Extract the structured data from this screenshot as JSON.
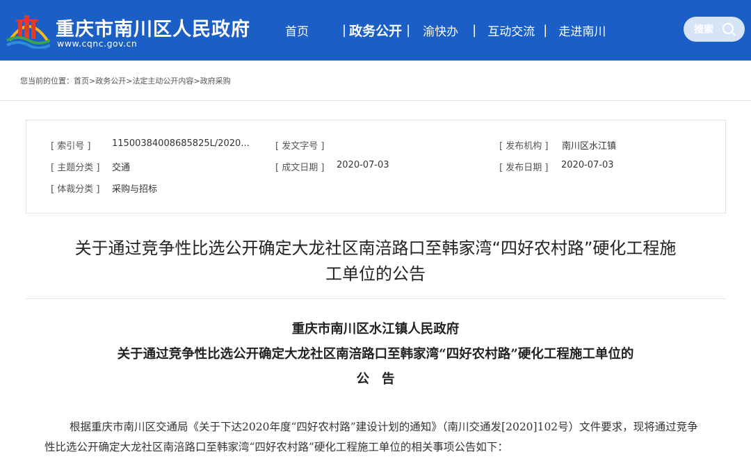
{
  "header": {
    "site_name": "重庆市南川区人民政府",
    "site_url": "www.cqnc.gov.cn",
    "nav": [
      {
        "label": "首页",
        "active": false
      },
      {
        "label": "政务公开",
        "active": true
      },
      {
        "label": "渝快办",
        "active": false
      },
      {
        "label": "互动交流",
        "active": false
      },
      {
        "label": "走进南川",
        "active": false
      }
    ],
    "nav_separator": "|",
    "search_label": "搜索",
    "colors": {
      "bar": "#1a5ec6",
      "search_bg": "#d7e4f5",
      "logo_red": "#e23b2a",
      "logo_yellow": "#f6b81a",
      "logo_green": "#3aa54a"
    }
  },
  "breadcrumb": {
    "prefix": "您当前的位置：",
    "items": [
      "首页",
      "政务公开",
      "法定主动公开内容",
      "政府采购"
    ],
    "separator": ">"
  },
  "meta": {
    "index_no_label": "[ 索引号 ]",
    "index_no_value": "11500384008685825L/2020...",
    "doc_no_label": "[ 发文字号 ]",
    "doc_no_value": "",
    "publisher_label": "[ 发布机构 ]",
    "publisher_value": "南川区水江镇",
    "topic_label": "[ 主题分类 ]",
    "topic_value": "交通",
    "written_date_label": "[ 成文日期 ]",
    "written_date_value": "2020-07-03",
    "publish_date_label": "[ 发布日期 ]",
    "publish_date_value": "2020-07-03",
    "genre_label": "[ 体裁分类 ]",
    "genre_value": "采购与招标"
  },
  "article": {
    "title_line1": "关于通过竞争性比选公开确定大龙社区南涪路口至韩家湾“四好农村路”硬化工程施",
    "title_line2": "工单位的公告",
    "issuer": "重庆市南川区水江镇人民政府",
    "subject": "关于通过竞争性比选公开确定大龙社区南涪路口至韩家湾“四好农村路”硬化工程施工单位的",
    "heading": "公告",
    "body": "根据重庆市南川区交通局《关于下达2020年度“四好农村路”建设计划的通知》（南川交通发[2020]102号）文件要求，现将通过竞争性比选公开确定大龙社区南涪路口至韩家湾“四好农村路”硬化工程施工单位的相关事项公告如下："
  }
}
